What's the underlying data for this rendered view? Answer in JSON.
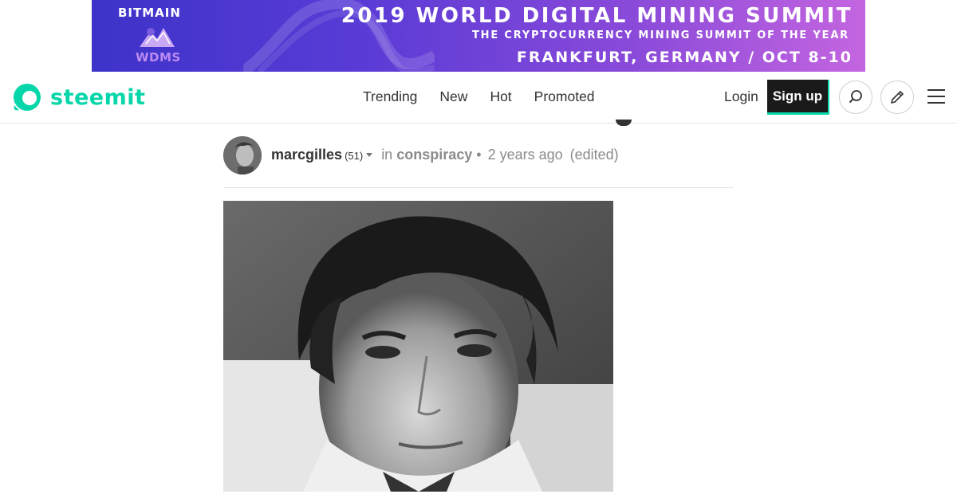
{
  "banner": {
    "brand": "BITMAIN",
    "sub_brand": "WDMS",
    "headline": "2019 WORLD DIGITAL MINING SUMMIT",
    "subheadline": "THE CRYPTOCURRENCY MINING SUMMIT OF THE YEAR",
    "location": "FRANKFURT, GERMANY / OCT 8-10"
  },
  "header": {
    "logo_text": "steemit",
    "nav": [
      "Trending",
      "New",
      "Hot",
      "Promoted"
    ],
    "login_label": "Login",
    "signup_label": "Sign up",
    "icons": [
      "search-icon",
      "pencil-icon",
      "hamburger-menu-icon"
    ]
  },
  "post": {
    "author": "marcgilles",
    "reputation": "(51)",
    "in_label": "in",
    "category": "conspiracy",
    "separator": "•",
    "time_ago": "2 years ago",
    "edited": "(edited)"
  },
  "colors": {
    "accent": "#06d6a9",
    "banner_start": "#3d33c9",
    "banner_end": "#c465e0",
    "signup_bg": "#1a1a1a",
    "muted_text": "#8a8a8a"
  }
}
